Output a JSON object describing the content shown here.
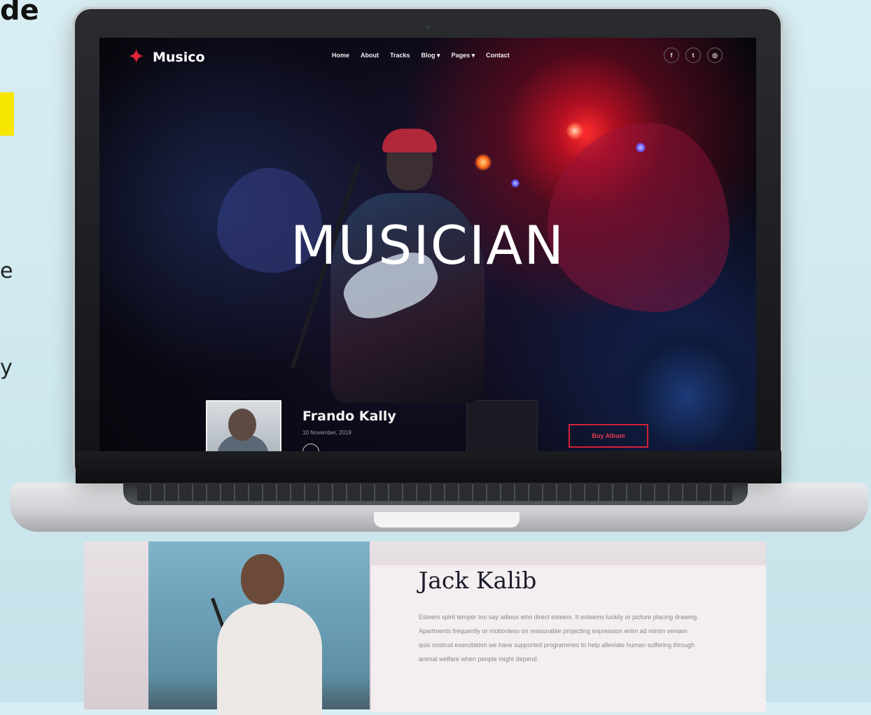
{
  "side": {
    "heading": "de",
    "chars": [
      "e",
      "y"
    ]
  },
  "site": {
    "logo": "Musico",
    "nav": [
      "Home",
      "About",
      "Tracks",
      "Blog ▾",
      "Pages ▾",
      "Contact"
    ],
    "social": [
      "f",
      "t",
      "◎"
    ],
    "hero_title": "MUSICIAN",
    "artist": {
      "name": "Frando Kally",
      "date": "10 November, 2019"
    },
    "buy_label": "Buy Album"
  },
  "section": {
    "title": "Jack Kalib",
    "body": "Esteem spirit temper too say adieus who direct esteem. It esteems luckily or picture placing drawing. Apartments frequently or motionless on reasonable projecting expression enim ad minim veniam quis nostrud exercitation we have supported programmes to help alleviate human suffering through animal welfare when people might depend."
  },
  "colors": {
    "accent": "#e0243a"
  }
}
